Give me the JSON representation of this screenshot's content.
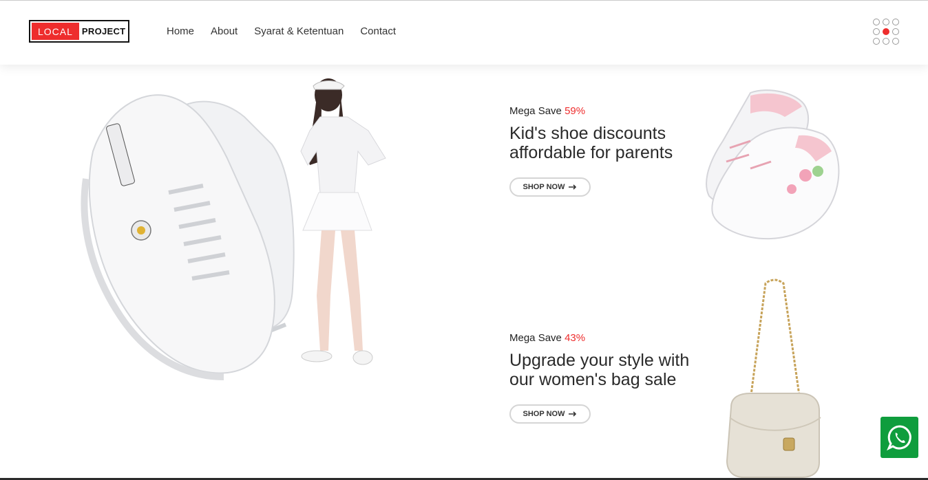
{
  "brand": {
    "logo_left": "LOCAL",
    "logo_right": "PROJECT"
  },
  "nav": {
    "items": [
      {
        "label": "Home"
      },
      {
        "label": "About"
      },
      {
        "label": "Syarat & Ketentuan"
      },
      {
        "label": "Contact"
      }
    ]
  },
  "promos": [
    {
      "tag_prefix": "Mega Save",
      "percent": "59%",
      "title_line1": "Kid's shoe discounts",
      "title_line2": "affordable for parents",
      "button": "SHOP NOW"
    },
    {
      "tag_prefix": "Mega Save",
      "percent": "43%",
      "title_line1": "Upgrade your style with",
      "title_line2": "our women's bag sale",
      "button": "SHOP NOW"
    }
  ],
  "icons": {
    "menu": "dots-grid-icon",
    "arrow": "arrow-right-icon",
    "chat": "whatsapp-icon"
  },
  "colors": {
    "accent": "#ee2d2d",
    "whatsapp": "#0f9d3d"
  }
}
